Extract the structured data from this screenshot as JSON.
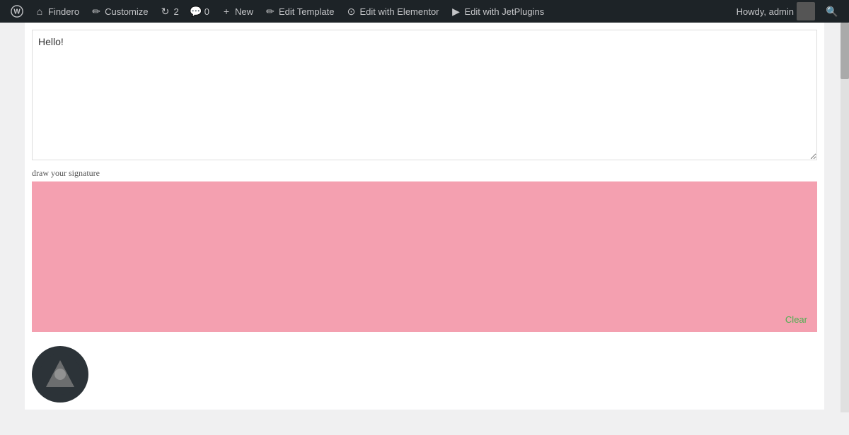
{
  "adminbar": {
    "wp_label": "WordPress",
    "findero_label": "Findero",
    "customize_label": "Customize",
    "updates_count": "2",
    "comments_count": "0",
    "new_label": "New",
    "edit_template_label": "Edit Template",
    "edit_elementor_label": "Edit with Elementor",
    "edit_jetplugins_label": "Edit with JetPlugins",
    "howdy_label": "Howdy, admin"
  },
  "content": {
    "textarea_value": "Hello!",
    "signature_label": "draw your signature",
    "clear_button": "Clear"
  },
  "colors": {
    "signature_bg": "#f4a0b0",
    "clear_color": "#4caf50"
  }
}
